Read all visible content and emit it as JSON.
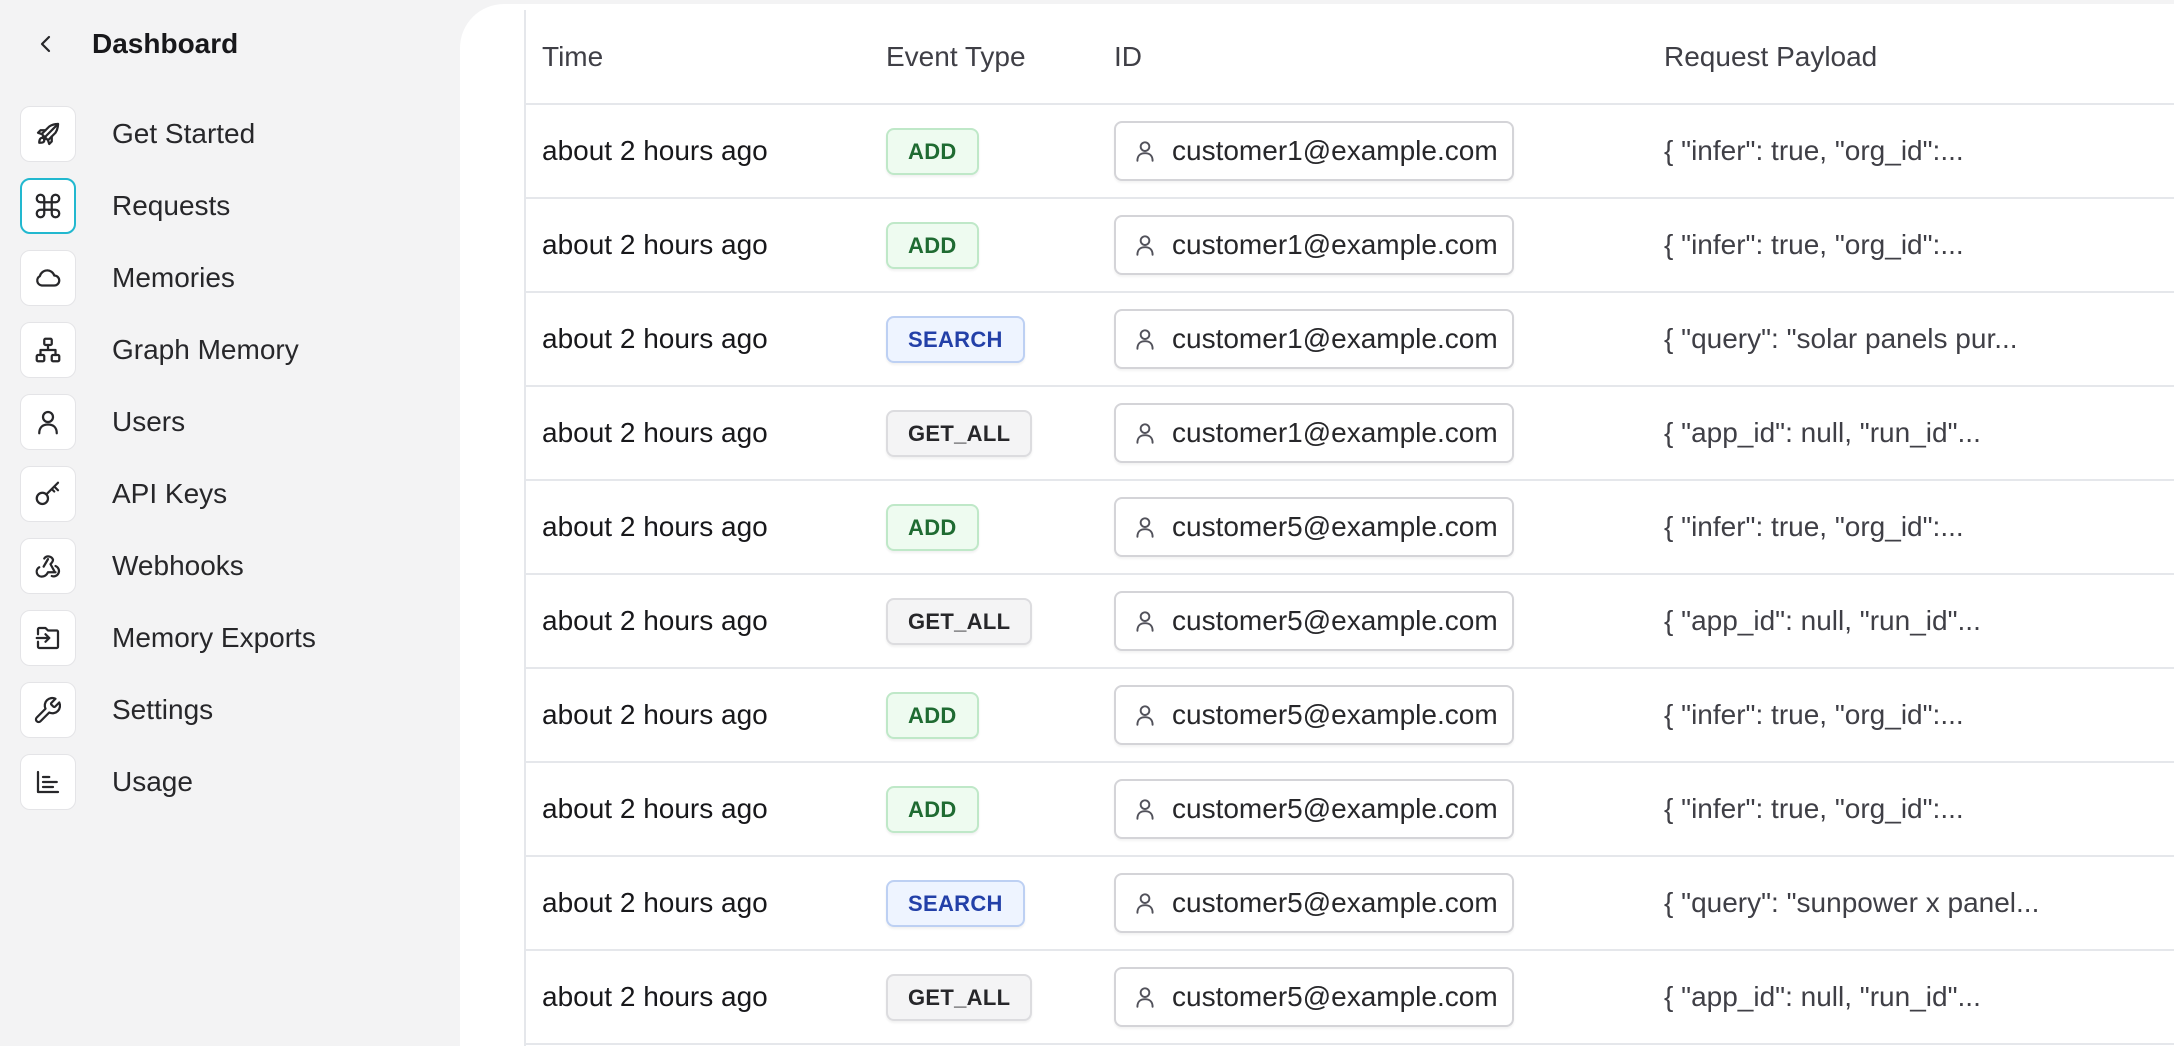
{
  "sidebar": {
    "title": "Dashboard",
    "items": [
      {
        "label": "Get Started",
        "icon": "rocket-icon"
      },
      {
        "label": "Requests",
        "icon": "command-icon",
        "active": true
      },
      {
        "label": "Memories",
        "icon": "cloud-icon"
      },
      {
        "label": "Graph Memory",
        "icon": "network-icon"
      },
      {
        "label": "Users",
        "icon": "user-icon"
      },
      {
        "label": "API Keys",
        "icon": "key-icon"
      },
      {
        "label": "Webhooks",
        "icon": "webhook-icon"
      },
      {
        "label": "Memory Exports",
        "icon": "export-icon"
      },
      {
        "label": "Settings",
        "icon": "wrench-icon"
      },
      {
        "label": "Usage",
        "icon": "chart-icon"
      }
    ]
  },
  "table": {
    "columns": [
      "Time",
      "Event Type",
      "ID",
      "Request Payload"
    ],
    "rows": [
      {
        "time": "about 2 hours ago",
        "type": "ADD",
        "id": "customer1@example.com",
        "payload": "{ \"infer\": true, \"org_id\":..."
      },
      {
        "time": "about 2 hours ago",
        "type": "ADD",
        "id": "customer1@example.com",
        "payload": "{ \"infer\": true, \"org_id\":..."
      },
      {
        "time": "about 2 hours ago",
        "type": "SEARCH",
        "id": "customer1@example.com",
        "payload": "{ \"query\": \"solar panels pur..."
      },
      {
        "time": "about 2 hours ago",
        "type": "GET_ALL",
        "id": "customer1@example.com",
        "payload": "{ \"app_id\": null, \"run_id\"..."
      },
      {
        "time": "about 2 hours ago",
        "type": "ADD",
        "id": "customer5@example.com",
        "payload": "{ \"infer\": true, \"org_id\":..."
      },
      {
        "time": "about 2 hours ago",
        "type": "GET_ALL",
        "id": "customer5@example.com",
        "payload": "{ \"app_id\": null, \"run_id\"..."
      },
      {
        "time": "about 2 hours ago",
        "type": "ADD",
        "id": "customer5@example.com",
        "payload": "{ \"infer\": true, \"org_id\":..."
      },
      {
        "time": "about 2 hours ago",
        "type": "ADD",
        "id": "customer5@example.com",
        "payload": "{ \"infer\": true, \"org_id\":..."
      },
      {
        "time": "about 2 hours ago",
        "type": "SEARCH",
        "id": "customer5@example.com",
        "payload": "{ \"query\": \"sunpower x panel..."
      },
      {
        "time": "about 2 hours ago",
        "type": "GET_ALL",
        "id": "customer5@example.com",
        "payload": "{ \"app_id\": null, \"run_id\"..."
      }
    ]
  },
  "colors": {
    "active_accent": "#22b8cf",
    "add_badge": "#1f6b32",
    "search_badge": "#2340a8",
    "get_all_badge": "#27272a"
  }
}
